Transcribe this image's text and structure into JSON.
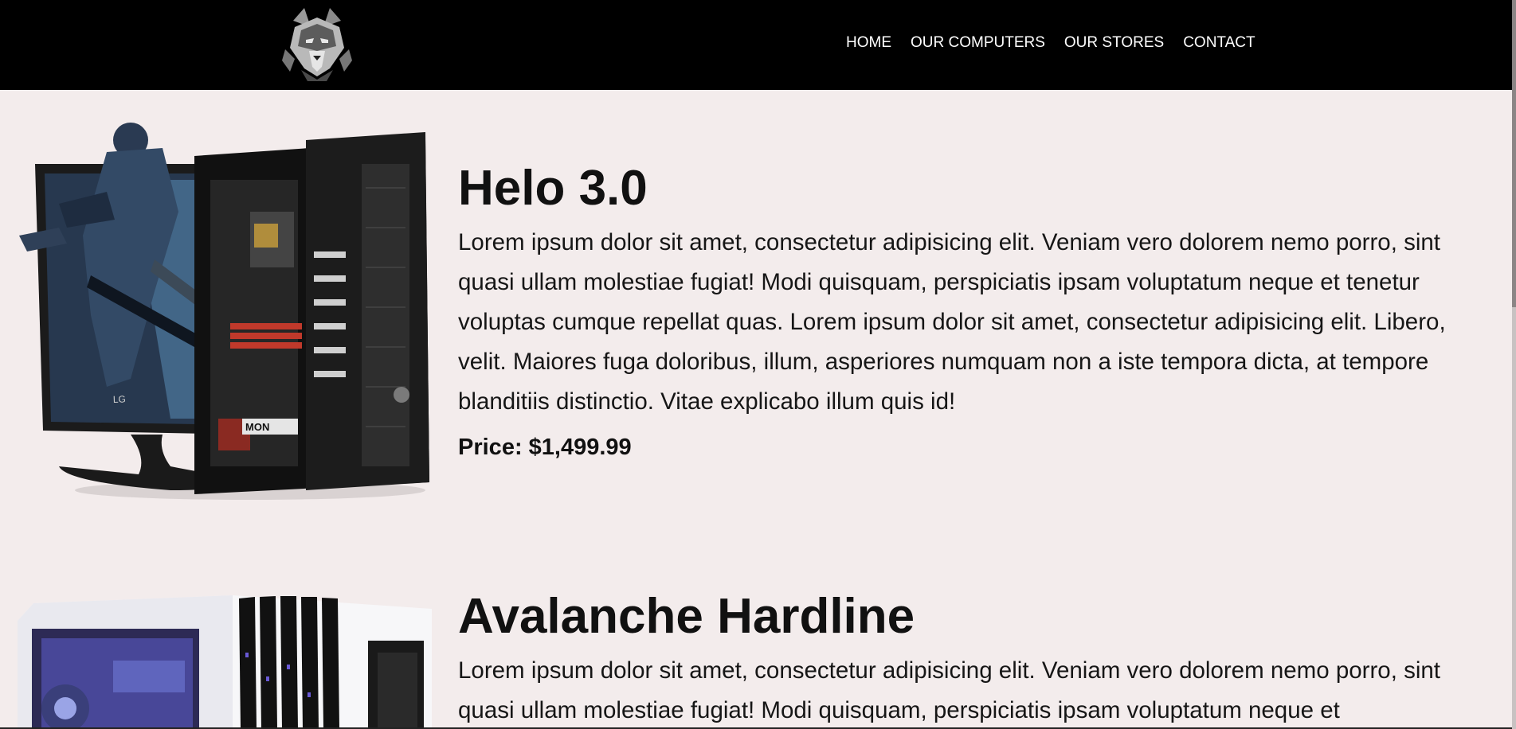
{
  "header": {
    "logo_icon": "wolf-logo-icon",
    "nav": [
      {
        "label": "HOME"
      },
      {
        "label": "OUR COMPUTERS"
      },
      {
        "label": "OUR STORES"
      },
      {
        "label": "CONTACT"
      }
    ]
  },
  "products": [
    {
      "name": "Helo 3.0",
      "description": "Lorem ipsum dolor sit amet, consectetur adipisicing elit. Veniam vero dolorem nemo porro, sint quasi ullam molestiae fugiat! Modi quisquam, perspiciatis ipsam voluptatum neque et tenetur voluptas cumque repellat quas. Lorem ipsum dolor sit amet, consectetur adipisicing elit. Libero, velit. Maiores fuga doloribus, illum, asperiores numquam non a iste tempora dicta, at tempore blanditiis distinctio. Vitae explicabo illum quis id!",
      "price": "Price: $1,499.99",
      "image": "gaming-pc-with-monitor-image"
    },
    {
      "name": "Avalanche Hardline",
      "description": "Lorem ipsum dolor sit amet, consectetur adipisicing elit. Veniam vero dolorem nemo porro, sint quasi ullam molestiae fugiat! Modi quisquam, perspiciatis ipsam voluptatum neque et",
      "image": "white-pc-case-image"
    }
  ]
}
